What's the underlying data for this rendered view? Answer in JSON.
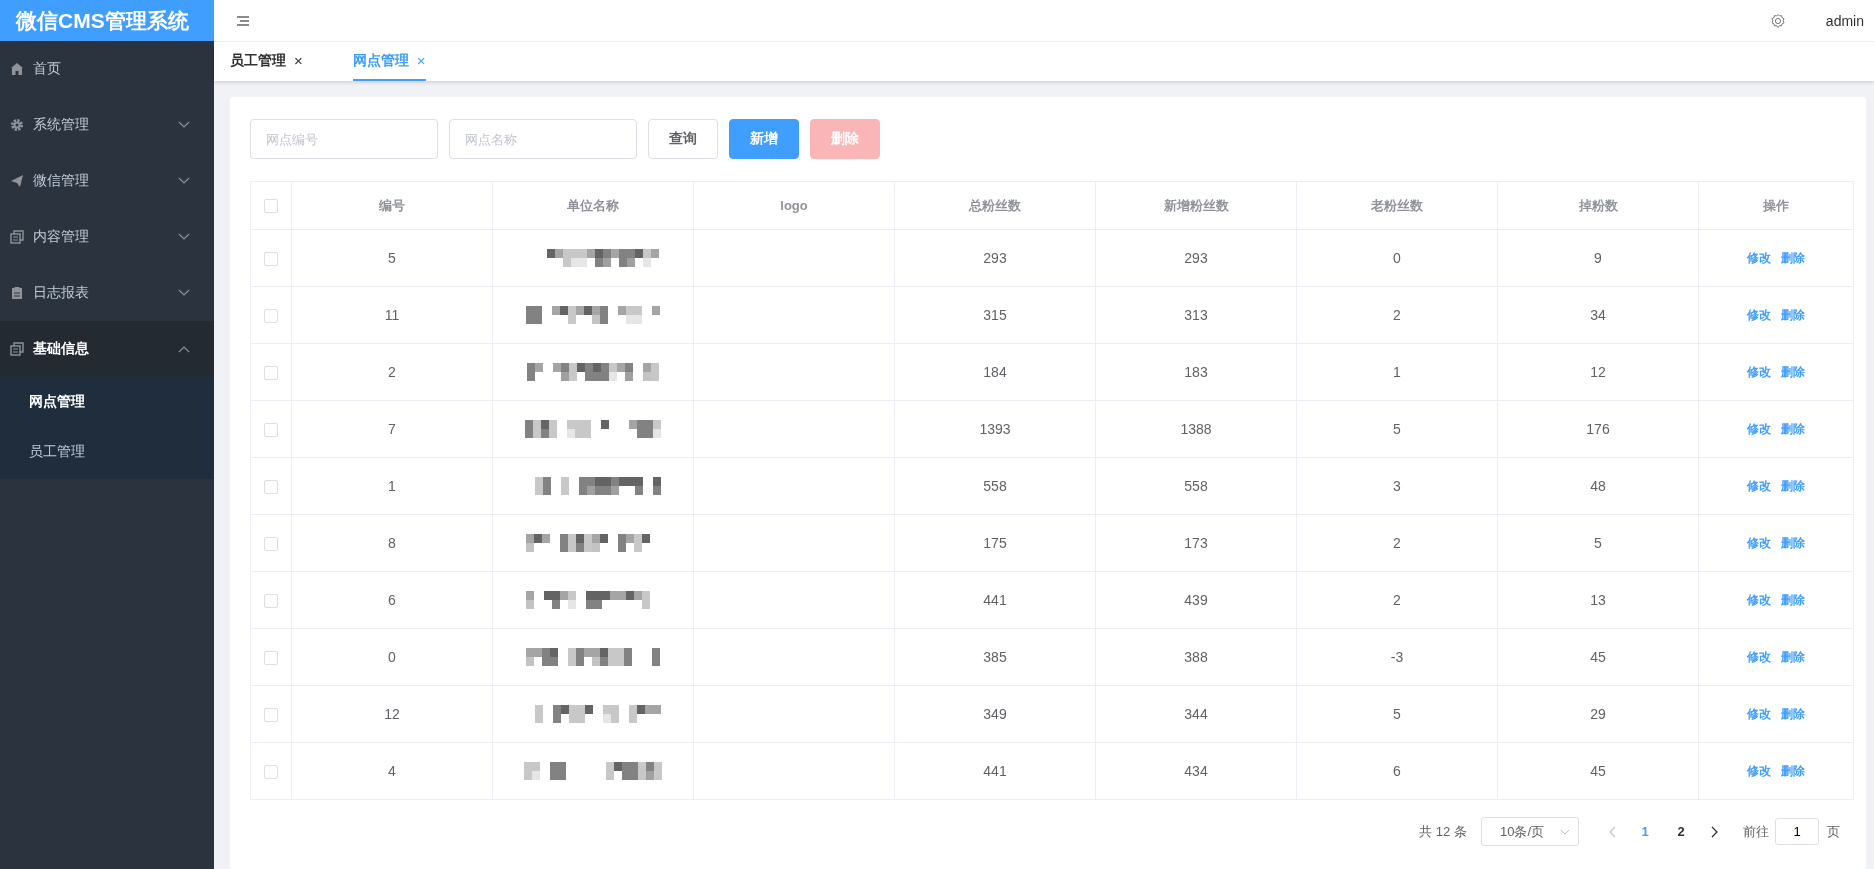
{
  "app_title": "微信CMS管理系统",
  "header": {
    "user": "admin"
  },
  "sidebar": {
    "items": [
      {
        "label": "首页"
      },
      {
        "label": "系统管理",
        "expanded": false
      },
      {
        "label": "微信管理",
        "expanded": false
      },
      {
        "label": "内容管理",
        "expanded": false
      },
      {
        "label": "日志报表",
        "expanded": false
      },
      {
        "label": "基础信息",
        "expanded": true,
        "children": [
          {
            "label": "网点管理",
            "selected": true
          },
          {
            "label": "员工管理",
            "selected": false
          }
        ]
      }
    ]
  },
  "tabs": [
    {
      "label": "员工管理",
      "close": "×",
      "selected": false
    },
    {
      "label": "网点管理",
      "close": "×",
      "selected": true
    }
  ],
  "filters": [
    {
      "placeholder": "网点编号"
    },
    {
      "placeholder": "网点名称"
    }
  ],
  "buttons": [
    {
      "label": "查询",
      "kind": "default",
      "disabled": false
    },
    {
      "label": "新增",
      "kind": "primary",
      "disabled": false
    },
    {
      "label": "删除",
      "kind": "danger",
      "disabled": true
    }
  ],
  "table": {
    "all_checked": false,
    "columns": [
      "编号",
      "单位名称",
      "logo",
      "总粉丝数",
      "新增粉丝数",
      "老粉丝数",
      "掉粉数",
      "操作"
    ],
    "rows": [
      {
        "checked": false,
        "id": "5",
        "total": "293",
        "new": "293",
        "old": "0",
        "lost": "9",
        "actions": [
          "修改",
          "删除"
        ]
      },
      {
        "checked": false,
        "id": "11",
        "total": "315",
        "new": "313",
        "old": "2",
        "lost": "34",
        "actions": [
          "修改",
          "删除"
        ]
      },
      {
        "checked": false,
        "id": "2",
        "total": "184",
        "new": "183",
        "old": "1",
        "lost": "12",
        "actions": [
          "修改",
          "删除"
        ]
      },
      {
        "checked": false,
        "id": "7",
        "total": "1393",
        "new": "1388",
        "old": "5",
        "lost": "176",
        "actions": [
          "修改",
          "删除"
        ]
      },
      {
        "checked": false,
        "id": "1",
        "total": "558",
        "new": "558",
        "old": "3",
        "lost": "48",
        "actions": [
          "修改",
          "删除"
        ]
      },
      {
        "checked": false,
        "id": "8",
        "total": "175",
        "new": "173",
        "old": "2",
        "lost": "5",
        "actions": [
          "修改",
          "删除"
        ]
      },
      {
        "checked": false,
        "id": "6",
        "total": "441",
        "new": "439",
        "old": "2",
        "lost": "13",
        "actions": [
          "修改",
          "删除"
        ]
      },
      {
        "checked": false,
        "id": "0",
        "total": "385",
        "new": "388",
        "old": "-3",
        "lost": "45",
        "actions": [
          "修改",
          "删除"
        ]
      },
      {
        "checked": false,
        "id": "12",
        "total": "349",
        "new": "344",
        "old": "5",
        "lost": "29",
        "actions": [
          "修改",
          "删除"
        ]
      },
      {
        "checked": false,
        "id": "4",
        "total": "441",
        "new": "434",
        "old": "6",
        "lost": "45",
        "actions": [
          "修改",
          "删除"
        ]
      }
    ]
  },
  "pagination": {
    "total": "共 12 条",
    "page_size": "10条/页",
    "pages": [
      {
        "label": "1",
        "selected": true
      },
      {
        "label": "2",
        "selected": false
      }
    ],
    "prev_disabled": true,
    "next_disabled": false,
    "goto_label": "前往",
    "goto_value": "1",
    "goto_suffix": "页"
  }
}
